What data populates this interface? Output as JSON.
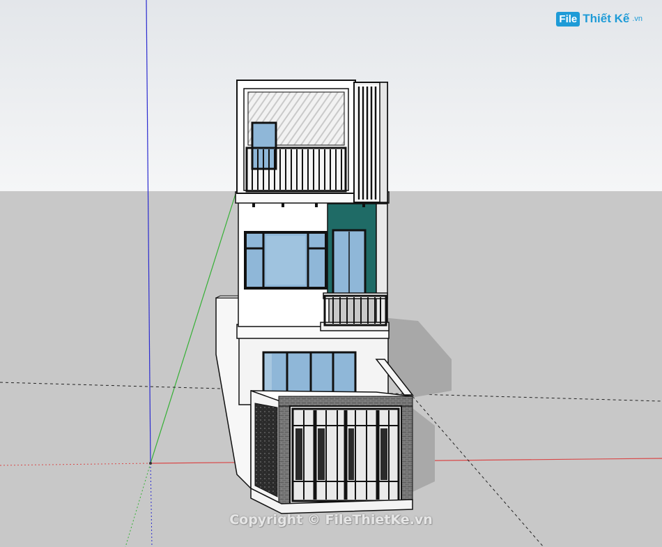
{
  "colors": {
    "sky_top": "#e7e9ec",
    "sky_bottom": "#f4f5f6",
    "ground": "#c8c8c8",
    "glass": "#8fb7d8",
    "teal_panel": "#1f6b66",
    "wall": "#ffffff",
    "frame": "#1a1a1a",
    "brick": "#7d7d7d",
    "axis_red": "#d94848",
    "axis_green": "#35b035",
    "axis_blue": "#2a2ad0",
    "logo_blue": "#1e9bd7"
  },
  "watermark": {
    "logo_box": "File",
    "logo_text": "Thiết Kế",
    "logo_tld": ".vn",
    "copyright": "Copyright © FileThietKe.vn"
  },
  "icons": [
    "axis-origin-icon"
  ]
}
